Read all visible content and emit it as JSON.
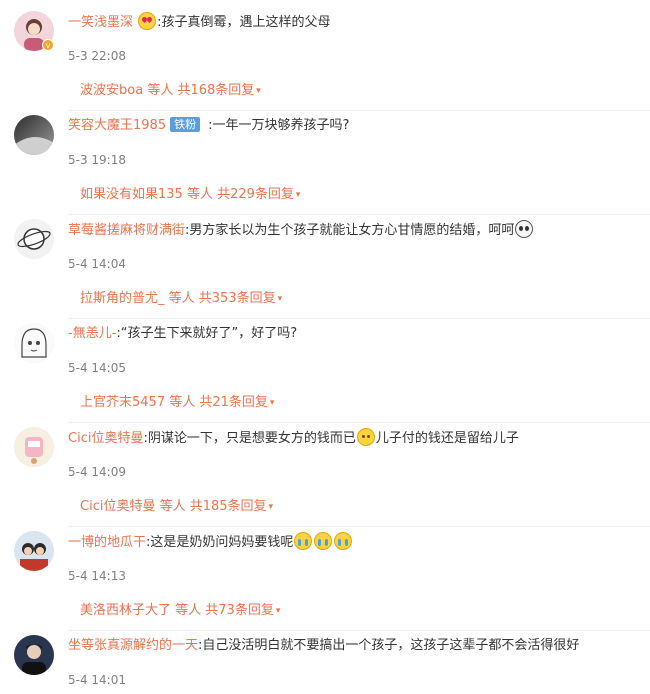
{
  "comments": [
    {
      "username": "一笑浅墨深",
      "text": ":孩子真倒霉，遇上这样的父母",
      "time": "5-3 22:08",
      "reply_user": "波波安boa",
      "reply_mid": " 等人 ",
      "reply_count": "共168条回复"
    },
    {
      "username": "笑容大魔王1985",
      "badge": "铁粉",
      "text": ":一年一万块够养孩子吗?",
      "time": "5-3 19:18",
      "reply_user": "如果没有如果135",
      "reply_mid": " 等人 ",
      "reply_count": "共229条回复"
    },
    {
      "username": "草莓酱搓麻将财满街",
      "text": ":男方家长以为生个孩子就能让女方心甘情愿的结婚，呵呵",
      "time": "5-4 14:04",
      "reply_user": "拉斯角的普尤_",
      "reply_mid": " 等人 ",
      "reply_count": "共353条回复"
    },
    {
      "username": "-無恙儿-",
      "text": ":“孩子生下来就好了”，好了吗?",
      "time": "5-4 14:05",
      "reply_user": "上官芥末5457",
      "reply_mid": " 等人 ",
      "reply_count": "共21条回复"
    },
    {
      "username": "Cici位奥特曼",
      "text": ":阴谋论一下，只是想要女方的钱而已",
      "text2": "儿子付的钱还是留给儿子",
      "time": "5-4 14:09",
      "reply_user": "Cici位奥特曼",
      "reply_mid": " 等人 ",
      "reply_count": "共185条回复"
    },
    {
      "username": "一博的地瓜干",
      "text": ":这是是奶奶问妈妈要钱呢",
      "time": "5-4 14:13",
      "reply_user": "美洛西林子大了",
      "reply_mid": " 等人 ",
      "reply_count": "共73条回复"
    },
    {
      "username": "坐等张真源解约的一天",
      "text": ":自己没活明白就不要搞出一个孩子，这孩子这辈子都不会活得很好",
      "time": "5-4 14:01"
    }
  ],
  "icons": {
    "caret": "▾",
    "verified": "v"
  },
  "colors": {
    "accent": "#eb7350",
    "muted": "#808080",
    "fan_badge": "#5b9ed9"
  }
}
